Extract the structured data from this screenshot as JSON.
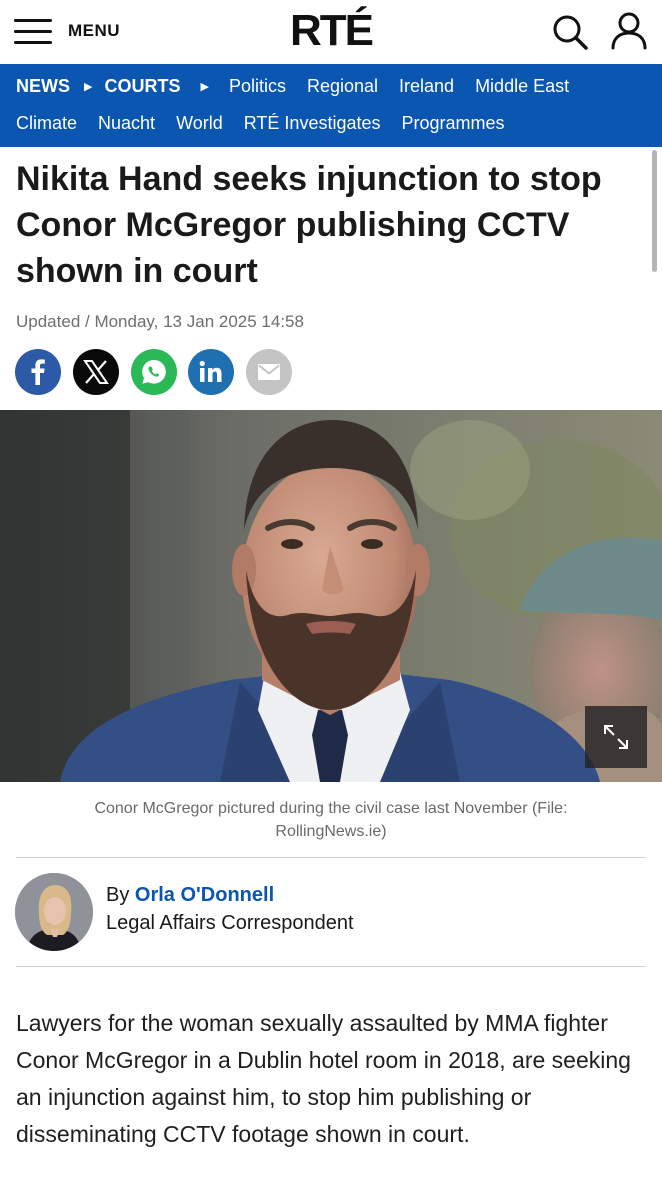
{
  "header": {
    "menu_label": "MENU",
    "logo_text": "RTÉ",
    "search_icon": "search-icon",
    "account_icon": "user-icon"
  },
  "nav": {
    "breadcrumb": [
      "NEWS",
      "COURTS"
    ],
    "row1": [
      "Politics",
      "Regional",
      "Ireland",
      "Middle East"
    ],
    "row2": [
      "Climate",
      "Nuacht",
      "World",
      "RTÉ Investigates",
      "Programmes"
    ],
    "background_color": "#0a56b0"
  },
  "article": {
    "headline": "Nikita Hand seeks injunction to stop Conor McGregor publishing CCTV shown in court",
    "updated": "Updated / Monday, 13 Jan 2025 14:58",
    "share": [
      "facebook-icon",
      "x-icon",
      "whatsapp-icon",
      "linkedin-icon",
      "email-icon"
    ],
    "image_caption": "Conor McGregor pictured during the civil case last November (File: RollingNews.ie)",
    "author": {
      "by": "By",
      "name": "Orla O'Donnell",
      "role": "Legal Affairs Correspondent"
    },
    "body": "Lawyers for the woman sexually assaulted by MMA fighter Conor McGregor in a Dublin hotel room in 2018, are seeking an injunction against him, to stop him publishing or disseminating CCTV footage shown in court."
  }
}
